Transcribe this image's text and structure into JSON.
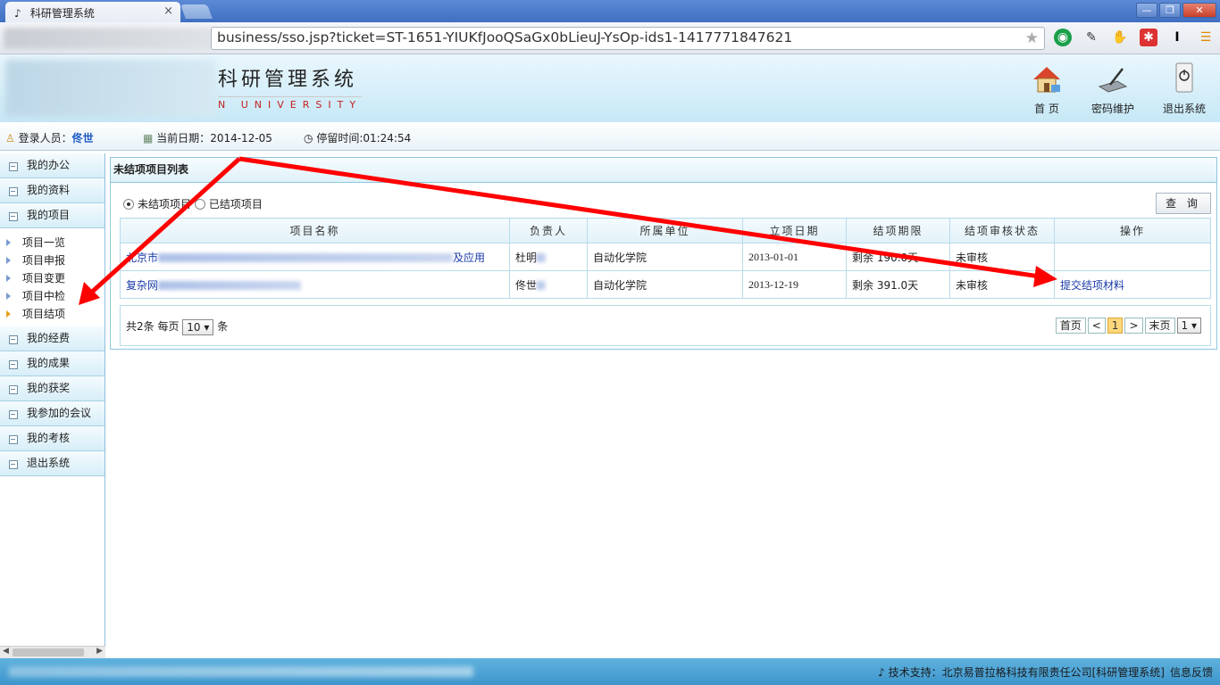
{
  "browser": {
    "tab_title": "科研管理系统",
    "tab_close": "×",
    "address": "business/sso.jsp?ticket=ST-1651-YIUKfJooQSaGx0bLieuJ-YsOp-ids1-1417771847621",
    "win_min": "—",
    "win_max": "❐",
    "win_close": "✕"
  },
  "header": {
    "system_title": "科研管理系统",
    "subtitle": "N UNIVERSITY",
    "home_label": "首 页",
    "password_label": "密码维护",
    "logout_label": "退出系统"
  },
  "infobar": {
    "login_label": "登录人员：",
    "login_user": "佟世",
    "date_label": "当前日期：",
    "date_value": "2014-12-05",
    "stay_label": "停留时间:",
    "stay_value": "01:24:54"
  },
  "sidebar": {
    "menus_top": [
      {
        "label": "我的办公"
      },
      {
        "label": "我的资料"
      },
      {
        "label": "我的项目"
      }
    ],
    "submenus": [
      {
        "label": "项目一览"
      },
      {
        "label": "项目申报"
      },
      {
        "label": "项目变更"
      },
      {
        "label": "项目中检"
      },
      {
        "label": "项目结项"
      }
    ],
    "menus_bottom": [
      {
        "label": "我的经费"
      },
      {
        "label": "我的成果"
      },
      {
        "label": "我的获奖"
      },
      {
        "label": "我参加的会议"
      },
      {
        "label": "我的考核"
      },
      {
        "label": "退出系统"
      }
    ]
  },
  "main": {
    "panel_title": "未结项项目列表",
    "radio_unfinished": "未结项项目",
    "radio_finished": "已结项项目",
    "query_button": "查 询",
    "columns": [
      "项目名称",
      "负责人",
      "所属单位",
      "立项日期",
      "结项期限",
      "结项审核状态",
      "操作"
    ],
    "rows": [
      {
        "name_prefix": "北京市",
        "name_suffix": "及应用",
        "leader": "杜明",
        "unit": "自动化学院",
        "start_date": "2013-01-01",
        "deadline": "剩余 190.0天",
        "status": "未审核",
        "action": ""
      },
      {
        "name_prefix": "复杂网",
        "name_suffix": "",
        "leader": "佟世",
        "unit": "自动化学院",
        "start_date": "2013-12-19",
        "deadline": "剩余 391.0天",
        "status": "未审核",
        "action": "提交结项材料"
      }
    ],
    "pager": {
      "total_text": "共2条 每页",
      "per_page": "10 ▾",
      "unit": "条",
      "first": "首页",
      "prev": "<",
      "current": "1",
      "next": ">",
      "last": "末页",
      "page_select": "1 ▾"
    }
  },
  "footer": {
    "support": "技术支持：北京易普拉格科技有限责任公司[科研管理系统]",
    "feedback": "信息反馈"
  },
  "colors": {
    "header_bg": "#c6e8f6",
    "accent_link": "#1a3aa8",
    "annotation_arrow": "#ff0000",
    "footer_bg": "#3d95cc"
  }
}
